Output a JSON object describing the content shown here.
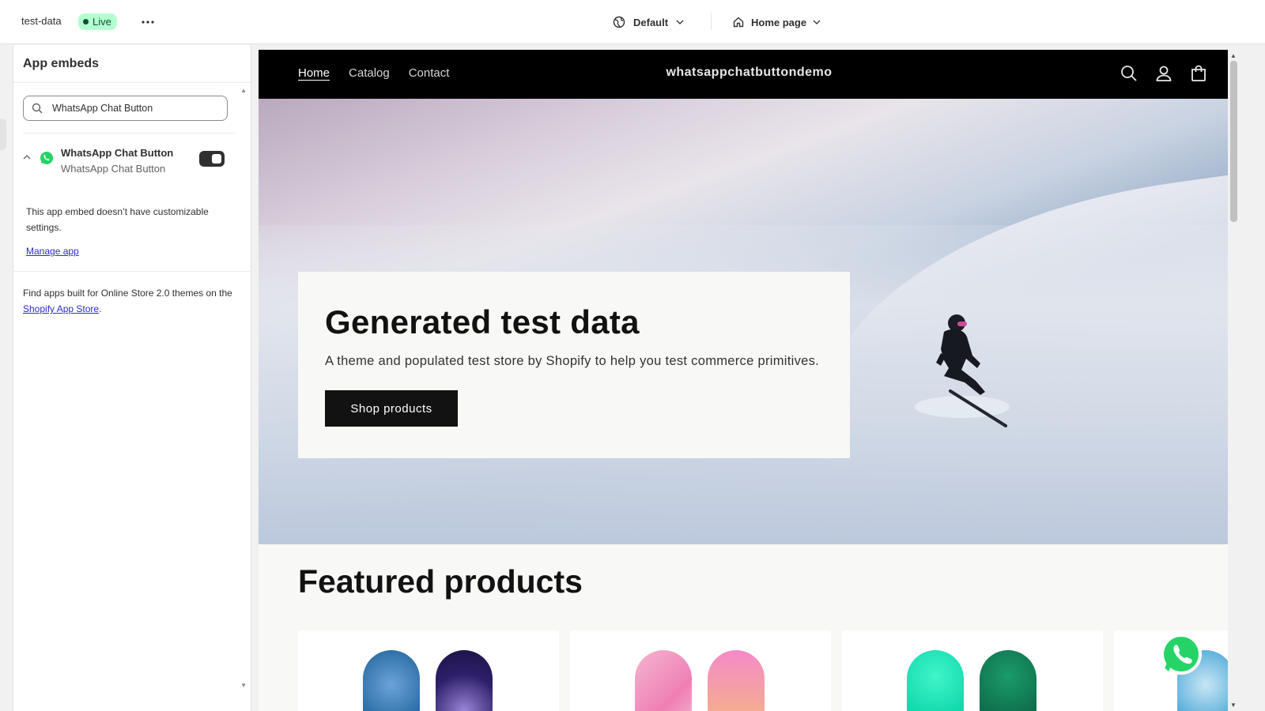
{
  "topbar": {
    "store_name": "test-data",
    "status_badge": "Live",
    "theme_label": "Default",
    "page_label": "Home page"
  },
  "sidebar": {
    "title": "App embeds",
    "search": {
      "value": "WhatsApp Chat Button",
      "placeholder": "Search"
    },
    "embed": {
      "title": "WhatsApp Chat Button",
      "subtitle": "WhatsApp Chat Button",
      "enabled": true,
      "note": "This app embed doesn’t have customizable settings.",
      "manage_link": "Manage app"
    },
    "footer_text": "Find apps built for Online Store 2.0 themes on the ",
    "footer_link": "Shopify App Store",
    "footer_end": "."
  },
  "preview": {
    "nav": [
      "Home",
      "Catalog",
      "Contact"
    ],
    "store_title": "whatsappchatbuttondemo",
    "hero": {
      "title": "Generated test data",
      "subtitle": "A theme and populated test store by Shopify to help you test commerce primitives.",
      "button": "Shop products"
    },
    "featured_title": "Featured products"
  },
  "colors": {
    "live_badge_bg": "#b4fed2",
    "link": "#2c2cc4",
    "whatsapp_green": "#25d366",
    "store_header_bg": "#000000"
  },
  "icons": [
    "more-icon",
    "globe-icon",
    "chevron-down-icon",
    "home-icon",
    "search-icon",
    "chevron-up-icon",
    "whatsapp-icon",
    "account-icon",
    "cart-icon"
  ]
}
